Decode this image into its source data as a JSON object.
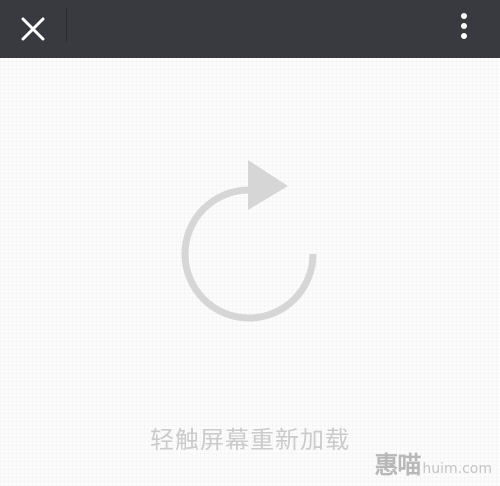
{
  "titlebar": {
    "close_icon": "close-icon",
    "menu_icon": "more-vertical-icon"
  },
  "content": {
    "reload_icon": "reload-icon",
    "reload_text": "轻触屏幕重新加载"
  },
  "watermark": {
    "logo": "惠喵",
    "url": "huim.com"
  },
  "colors": {
    "titlebar_bg": "#393a3f",
    "icon_white": "#ffffff",
    "content_bg": "#fcfcfc",
    "reload_gray": "#d6d6d6",
    "text_gray": "#cbcbcb"
  }
}
